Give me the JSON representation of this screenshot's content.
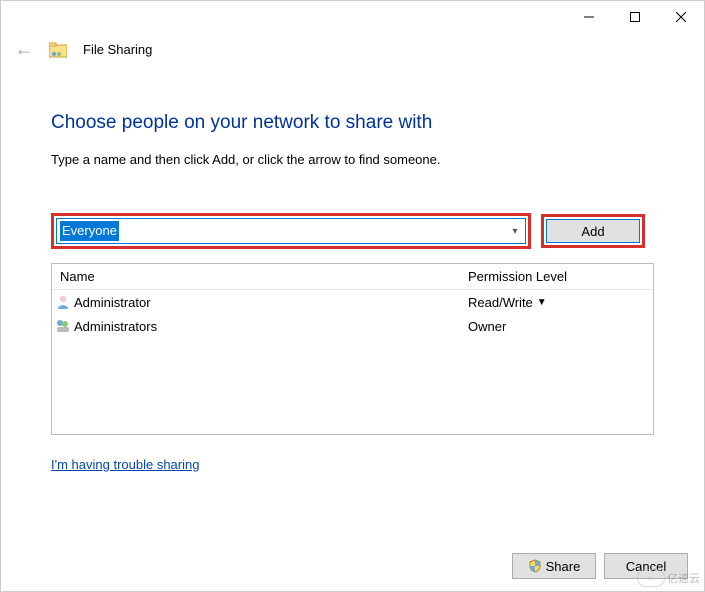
{
  "titlebar": {
    "minimize": "minimize",
    "maximize": "maximize",
    "close": "close"
  },
  "header": {
    "app_title": "File Sharing"
  },
  "main": {
    "heading": "Choose people on your network to share with",
    "subtext": "Type a name and then click Add, or click the arrow to find someone.",
    "combo_value": "Everyone",
    "add_button": "Add",
    "columns": {
      "name": "Name",
      "permission": "Permission Level"
    },
    "rows": [
      {
        "icon": "user",
        "name": "Administrator",
        "permission": "Read/Write",
        "has_dropdown": true
      },
      {
        "icon": "group",
        "name": "Administrators",
        "permission": "Owner",
        "has_dropdown": false
      }
    ],
    "trouble_link": "I'm having trouble sharing"
  },
  "footer": {
    "share": "Share",
    "cancel": "Cancel"
  },
  "watermark": "亿速云"
}
